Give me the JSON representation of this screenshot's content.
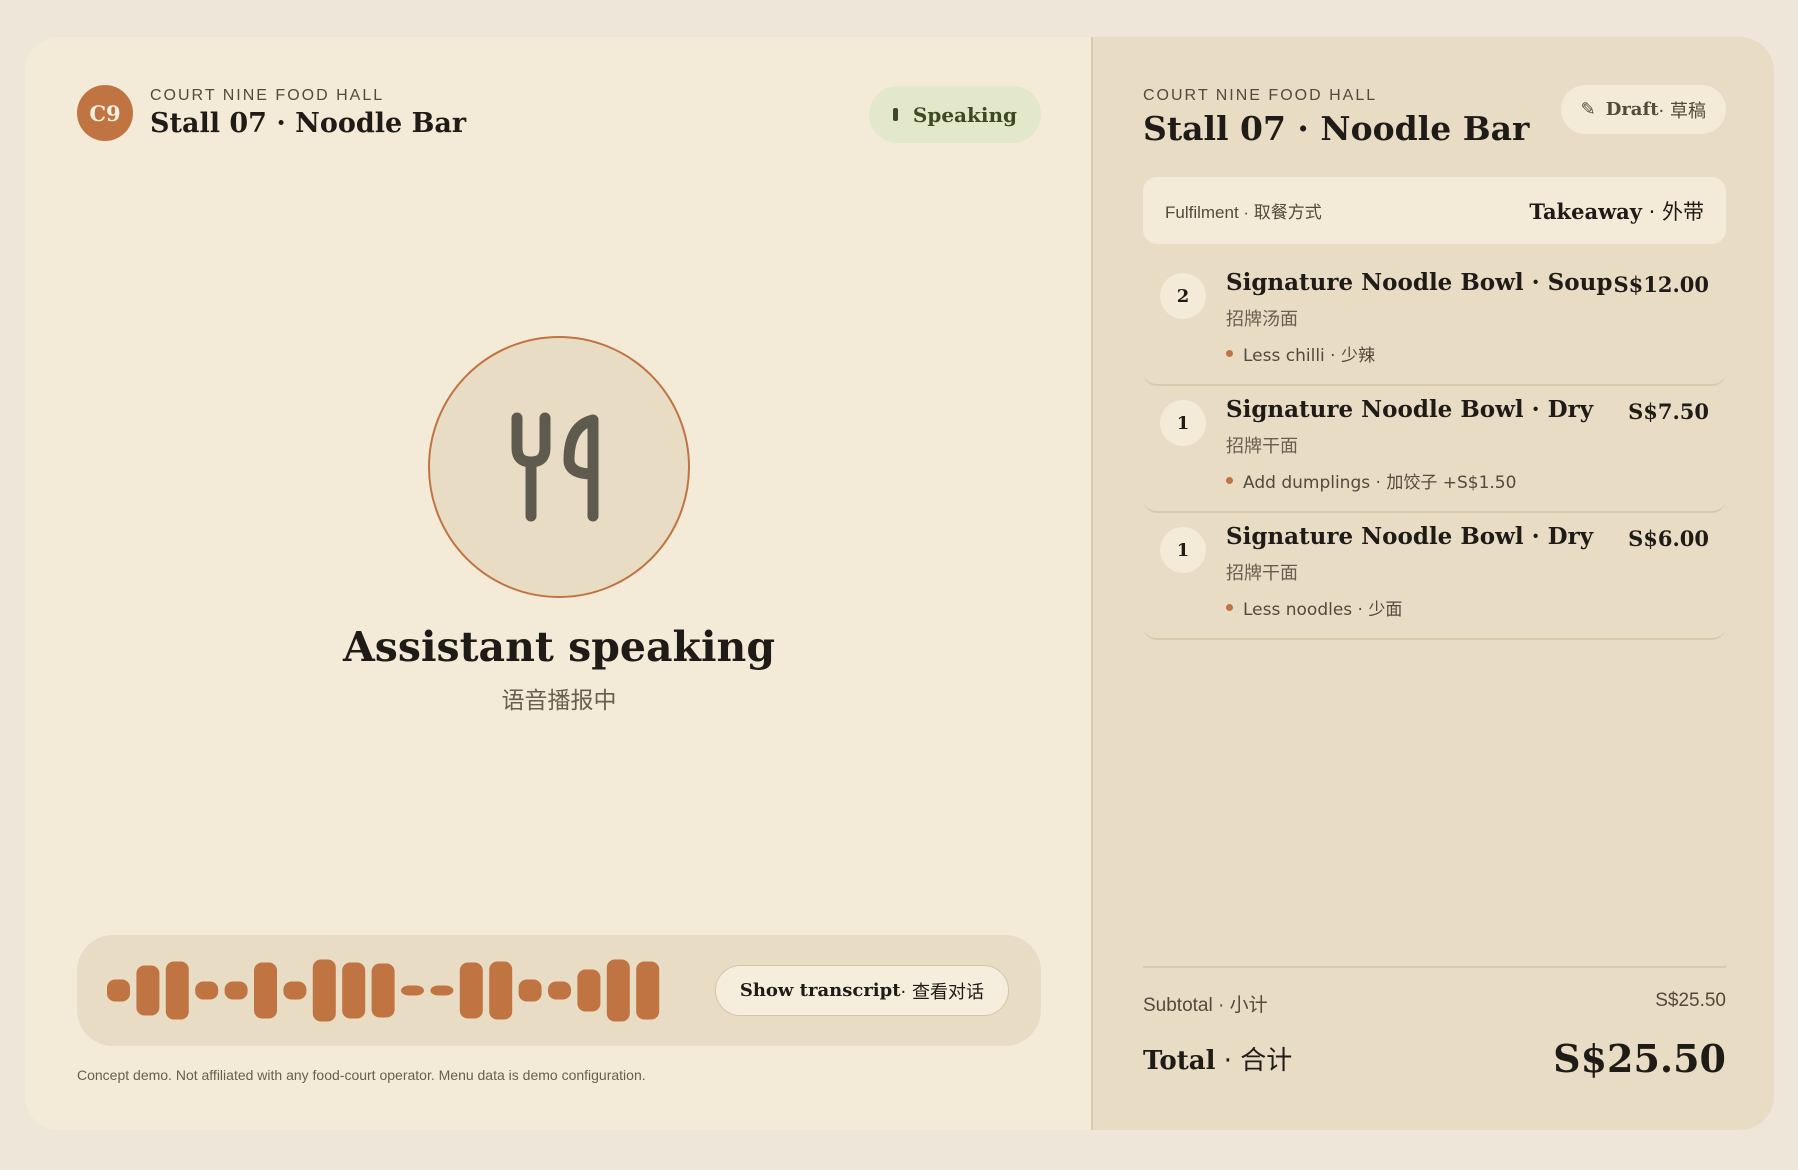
{
  "colors": {
    "accent": "#c07442",
    "speaking_bg": "#e2e8c9",
    "panel": "#e8dcc5",
    "page": "#f3ead7"
  },
  "left": {
    "logo_text": "C9",
    "venue": "COURT NINE FOOD HALL",
    "stall": "Stall 07 · Noodle Bar",
    "speaking_label": "Speaking",
    "status_title": "Assistant speaking",
    "status_sub": "语音播报中",
    "transcript_bold": "Show transcript",
    "transcript_rest": " · 查看对话",
    "footnote": "Concept demo. Not affiliated with any food-court operator. Menu data is demo configuration.",
    "avatar_icon": "fork-knife-icon"
  },
  "right": {
    "venue": "COURT NINE FOOD HALL",
    "stall": "Stall 07 · Noodle Bar",
    "draft_icon": "✎",
    "draft_bold": "Draft",
    "draft_rest": " · 草稿",
    "fulfilment_label": "Fulfilment · 取餐方式",
    "fulfilment_bold": "Takeaway",
    "fulfilment_rest": " · 外带",
    "items": [
      {
        "qty": "2",
        "name": "Signature Noodle Bowl · Soup",
        "cn": "招牌汤面",
        "mod": "Less chilli · 少辣",
        "price": "S$12.00"
      },
      {
        "qty": "1",
        "name": "Signature Noodle Bowl · Dry",
        "cn": "招牌干面",
        "mod": "Add dumplings · 加饺子 +S$1.50",
        "price": "S$7.50"
      },
      {
        "qty": "1",
        "name": "Signature Noodle Bowl · Dry",
        "cn": "招牌干面",
        "mod": "Less noodles · 少面",
        "price": "S$6.00"
      }
    ],
    "subtotal_label": "Subtotal · 小计",
    "subtotal_value": "S$25.50",
    "total_bold": "Total",
    "total_rest": " · 合计",
    "total_value": "S$25.50"
  }
}
